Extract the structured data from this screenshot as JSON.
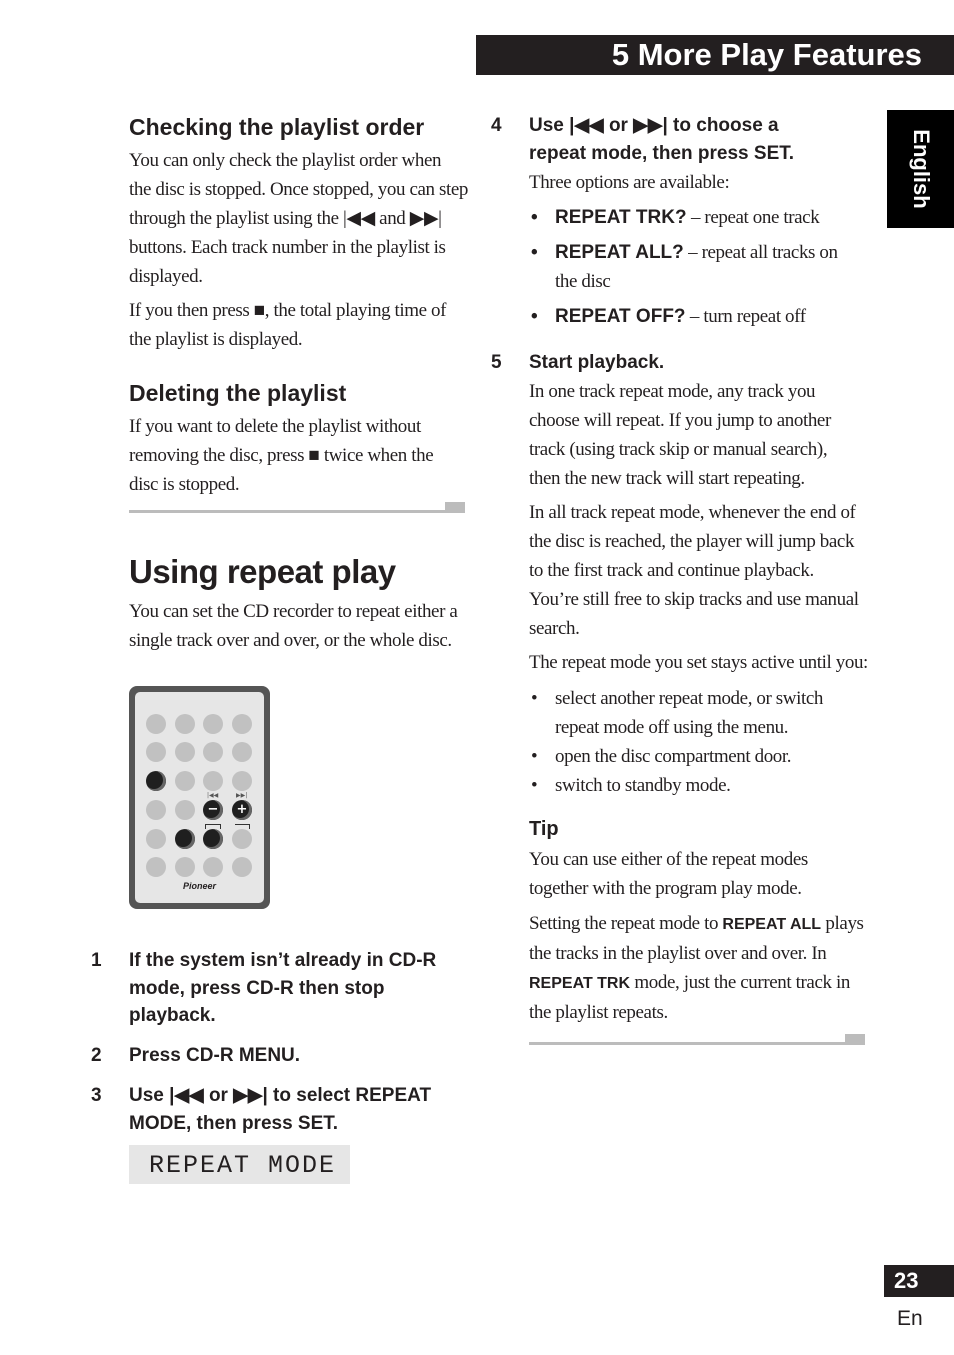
{
  "header": {
    "chapter_title": "5  More Play Features",
    "language_tab": "English"
  },
  "left_column": {
    "checking": {
      "heading": "Checking the playlist order",
      "para1": [
        "You can only check the playlist order when",
        "the disc is stopped. Once stopped, you can step",
        "through the playlist using the |◀◀ and ▶▶|",
        "buttons. Each track number in the playlist is",
        "displayed."
      ],
      "para2": [
        "If you then press ■, the total playing time of",
        "the playlist is displayed."
      ]
    },
    "deleting": {
      "heading": "Deleting the playlist",
      "para": [
        "If you want to delete the playlist without",
        "removing the disc, press ■ twice when the",
        "disc is stopped."
      ]
    },
    "repeat": {
      "heading": "Using repeat play",
      "para": [
        "You can set the CD recorder to repeat either a",
        "single track over and over, or the whole disc."
      ]
    },
    "remote": {
      "brand": "Pioneer",
      "minus_symbol": "−",
      "plus_symbol": "+",
      "prev_label": "|◀◀",
      "next_label": "▶▶|"
    },
    "steps": [
      {
        "num": "1",
        "lines": [
          "If the system isn’t already in CD-R",
          "mode, press CD-R then stop",
          "playback."
        ]
      },
      {
        "num": "2",
        "lines": [
          "Press CD-R MENU."
        ]
      },
      {
        "num": "3",
        "lines": [
          "Use |◀◀ or ▶▶| to select REPEAT",
          "MODE, then press SET."
        ]
      }
    ],
    "display": "REPEAT MODE"
  },
  "right_column": {
    "step4": {
      "num": "4",
      "lines": [
        "Use |◀◀ or ▶▶| to choose a",
        "repeat mode, then press SET."
      ],
      "intro": "Three options are available:",
      "options": [
        {
          "term": "REPEAT TRK?",
          "desc": " – repeat one track",
          "desc2": ""
        },
        {
          "term": "REPEAT ALL?",
          "desc": " – repeat all tracks on",
          "desc2": "the disc"
        },
        {
          "term": "REPEAT OFF?",
          "desc": " – turn repeat off",
          "desc2": ""
        }
      ]
    },
    "step5": {
      "num": "5",
      "title": "Start playback.",
      "para1": [
        "In one track repeat mode, any track you",
        "choose will repeat. If you jump to another",
        "track (using track skip or manual search),",
        "then the new track will start repeating."
      ],
      "para2": [
        "In all track repeat mode, whenever the end of",
        "the disc is reached, the player will jump back",
        "to the first track and continue playback.",
        "You’re still free to skip tracks and use manual",
        "search."
      ],
      "para3": "The repeat mode you set stays active until you:",
      "bullets": [
        [
          "select another repeat mode, or switch",
          "repeat mode off using the menu."
        ],
        [
          "open the disc compartment door."
        ],
        [
          "switch to standby mode."
        ]
      ]
    },
    "tip": {
      "heading": "Tip",
      "para1": [
        "You can use either of the repeat modes",
        "together with the program play mode."
      ],
      "para2": {
        "l1a": "Setting the repeat mode to ",
        "l1b": "REPEAT ALL",
        "l1c": " plays",
        "l2": "the tracks in the playlist over and over. In",
        "l3a": "REPEAT TRK",
        "l3b": " mode, just the current track in",
        "l4": "the playlist repeats."
      }
    }
  },
  "footer": {
    "page_number": "23",
    "language": "En"
  }
}
